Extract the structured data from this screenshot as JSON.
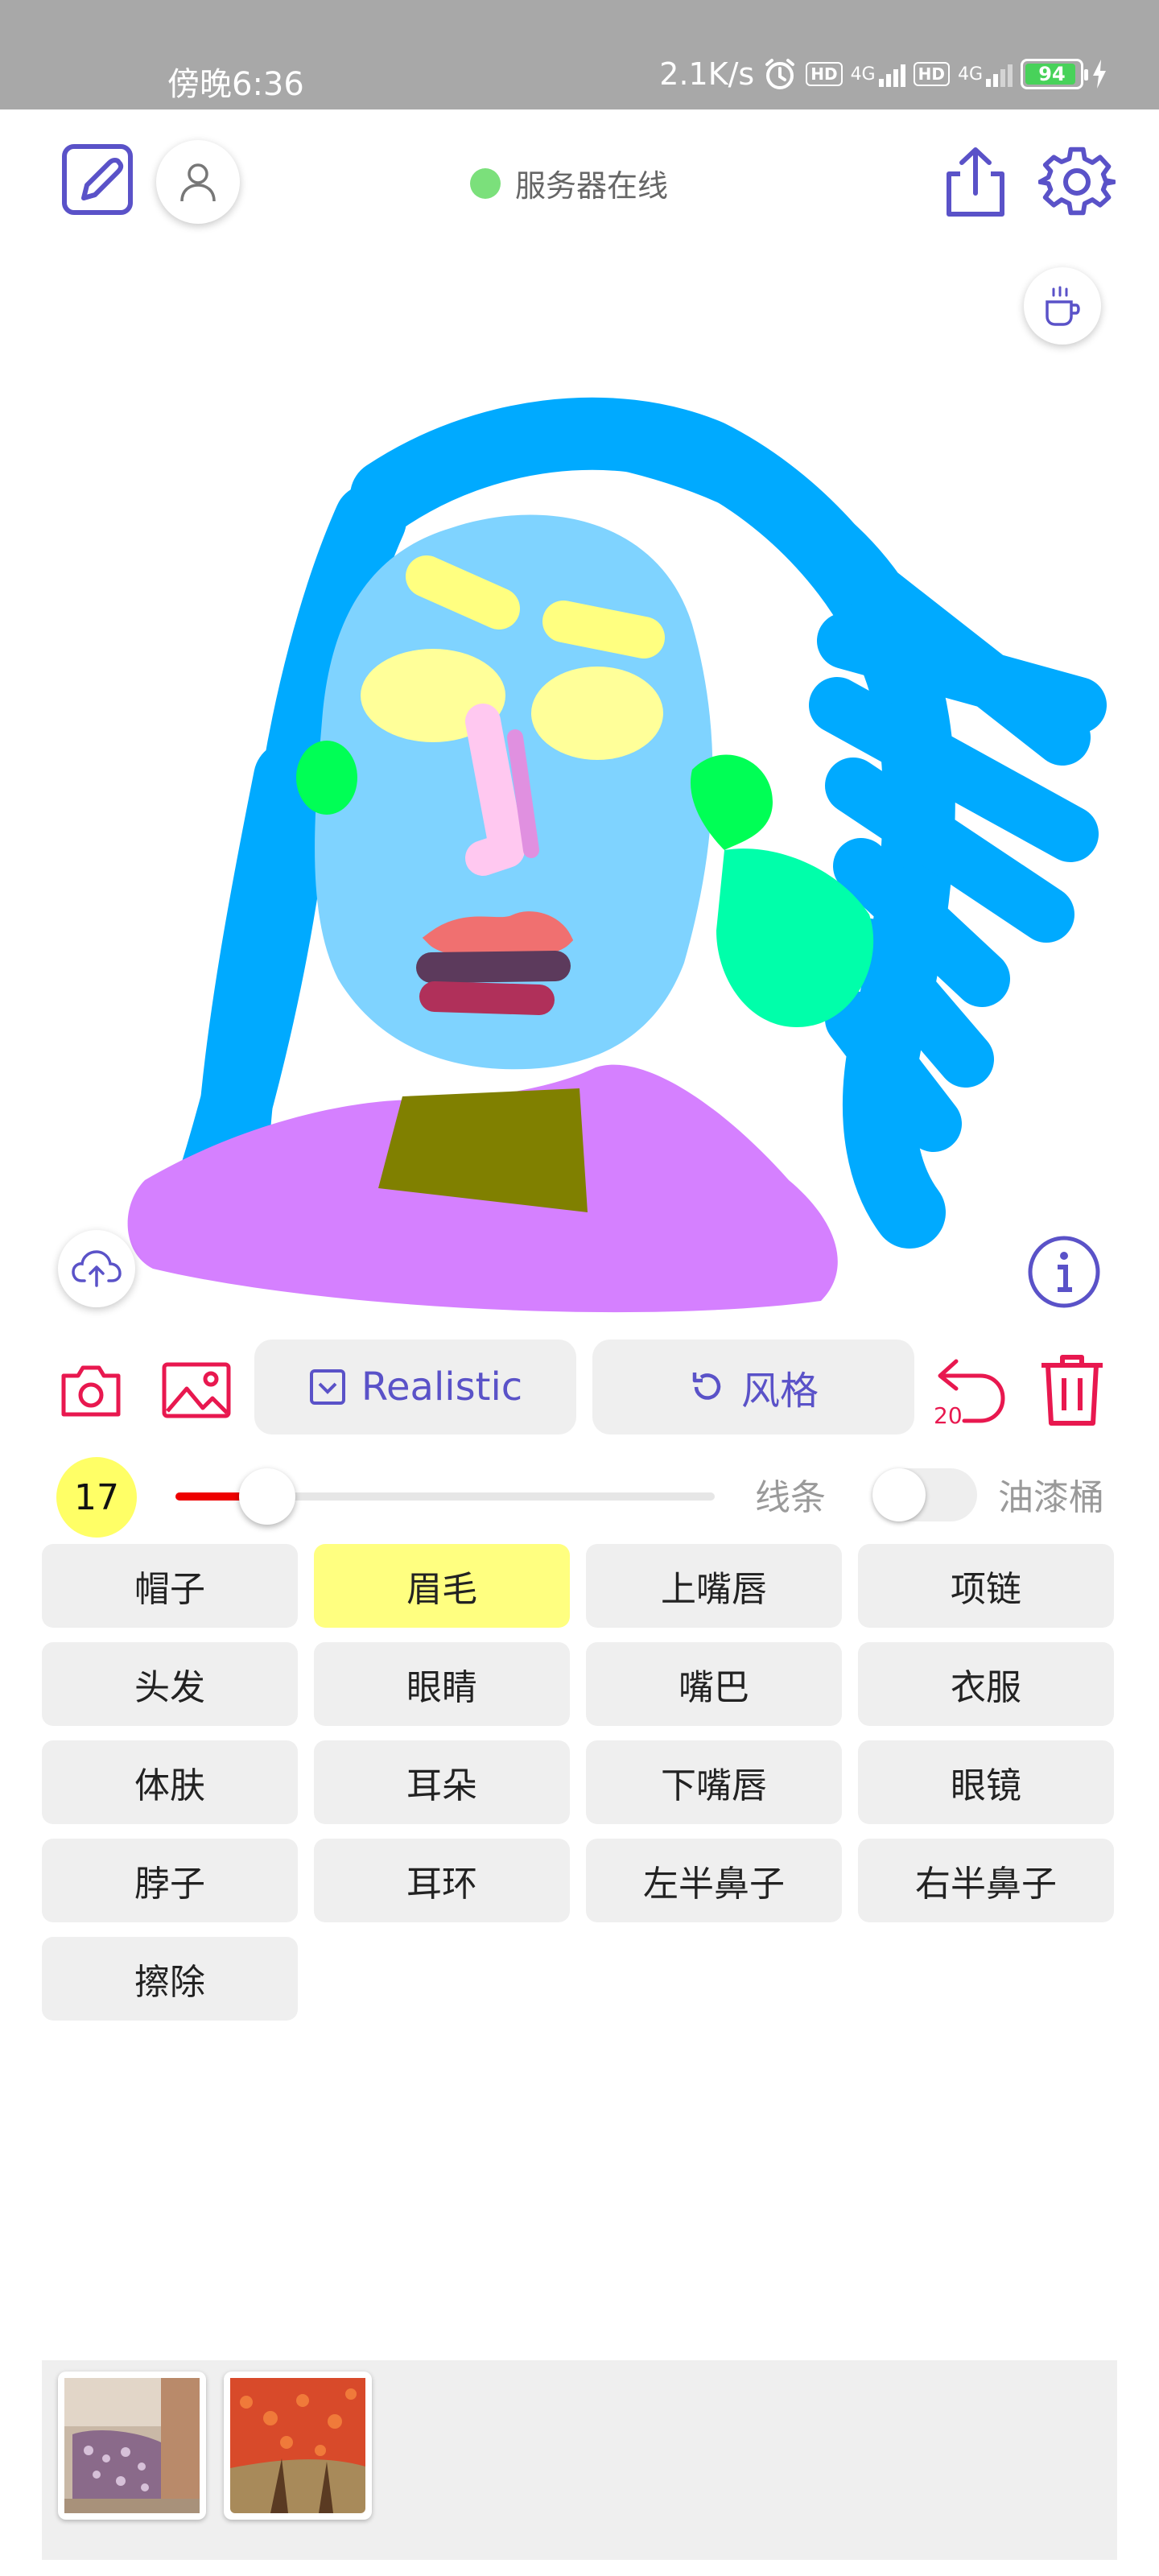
{
  "status_bar": {
    "time": "傍晚6:36",
    "net_speed": "2.1K/s",
    "network1": "4G",
    "network2": "4G",
    "hd": "HD",
    "battery": "94",
    "battery_level": 0.94
  },
  "header": {
    "server_status": "服务器在线",
    "server_status_color": "#7be07b"
  },
  "toolbar": {
    "style_label": "Realistic",
    "style_button_label": "风格",
    "undo_count": "20"
  },
  "brush": {
    "size": "17",
    "size_fraction": 0.17,
    "mode_line": "线条",
    "mode_bucket": "油漆桶",
    "bucket_enabled": false
  },
  "parts": [
    {
      "label": "帽子",
      "active": false
    },
    {
      "label": "眉毛",
      "active": true
    },
    {
      "label": "上嘴唇",
      "active": false
    },
    {
      "label": "项链",
      "active": false
    },
    {
      "label": "头发",
      "active": false
    },
    {
      "label": "眼睛",
      "active": false
    },
    {
      "label": "嘴巴",
      "active": false
    },
    {
      "label": "衣服",
      "active": false
    },
    {
      "label": "体肤",
      "active": false
    },
    {
      "label": "耳朵",
      "active": false
    },
    {
      "label": "下嘴唇",
      "active": false
    },
    {
      "label": "眼镜",
      "active": false
    },
    {
      "label": "脖子",
      "active": false
    },
    {
      "label": "耳环",
      "active": false
    },
    {
      "label": "左半鼻子",
      "active": false
    },
    {
      "label": "右半鼻子",
      "active": false
    },
    {
      "label": "擦除",
      "active": false
    }
  ],
  "colors": {
    "accent": "#5a52c8",
    "danger": "#e8184f",
    "hair": "#00aaff",
    "skin": "#7fd3ff",
    "eyebrow": "#ffff80",
    "eyes": "#ffff99",
    "ears": "#00ff55",
    "earring": "#00ffaa",
    "nose": "#ffc8f0",
    "upper_lip": "#f07070",
    "mouth": "#5c3a5c",
    "lower_lip": "#b0305a",
    "neck": "#808000",
    "clothes": "#d580ff"
  }
}
